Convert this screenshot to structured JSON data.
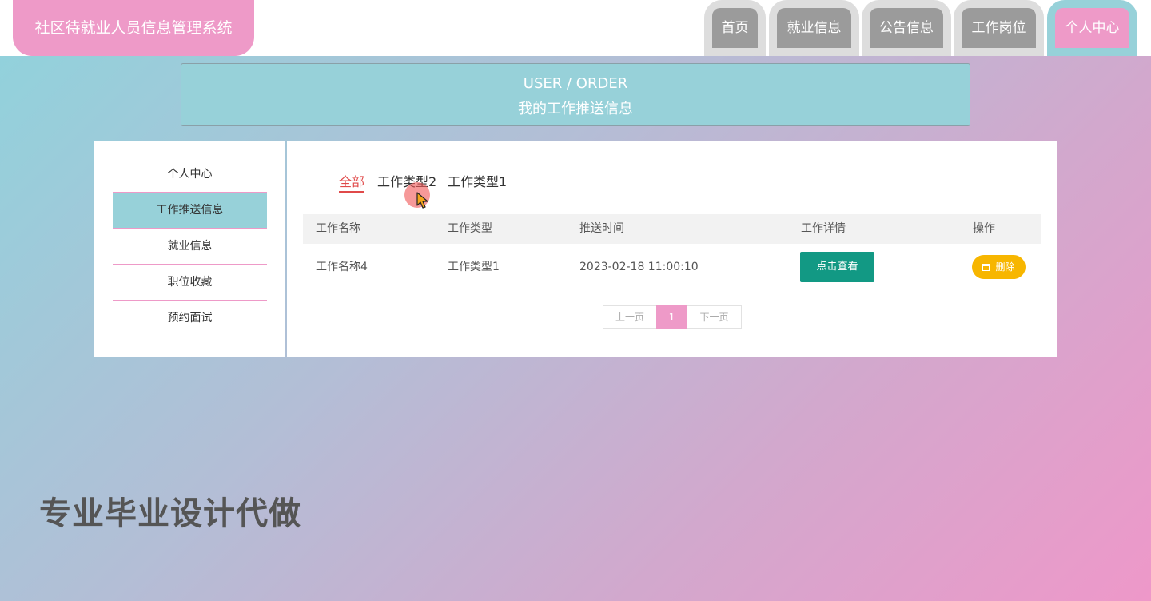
{
  "header": {
    "site_title": "社区待就业人员信息管理系统",
    "nav": [
      {
        "label": "首页"
      },
      {
        "label": "就业信息"
      },
      {
        "label": "公告信息"
      },
      {
        "label": "工作岗位"
      },
      {
        "label": "个人中心",
        "active": true
      }
    ]
  },
  "banner": {
    "en": "USER / ORDER",
    "cn": "我的工作推送信息"
  },
  "sidebar": {
    "items": [
      {
        "label": "个人中心"
      },
      {
        "label": "工作推送信息",
        "active": true
      },
      {
        "label": "就业信息"
      },
      {
        "label": "职位收藏"
      },
      {
        "label": "预约面试"
      }
    ]
  },
  "filters": [
    {
      "label": "全部",
      "active": true
    },
    {
      "label": "工作类型2"
    },
    {
      "label": "工作类型1"
    }
  ],
  "table": {
    "headers": [
      "工作名称",
      "工作类型",
      "推送时间",
      "工作详情",
      "操作"
    ],
    "rows": [
      {
        "name": "工作名称4",
        "type": "工作类型1",
        "time": "2023-02-18 11:00:10",
        "detail_button": "点击查看",
        "delete_button": "删除"
      }
    ]
  },
  "pagination": {
    "prev": "上一页",
    "current": "1",
    "next": "下一页"
  },
  "watermark": "专业毕业设计代做",
  "colors": {
    "accent_pink": "#ee9ac8",
    "accent_teal": "#97d1d9",
    "view_button": "#129984",
    "delete_button": "#f7b600",
    "filter_active": "#e04a4a"
  }
}
